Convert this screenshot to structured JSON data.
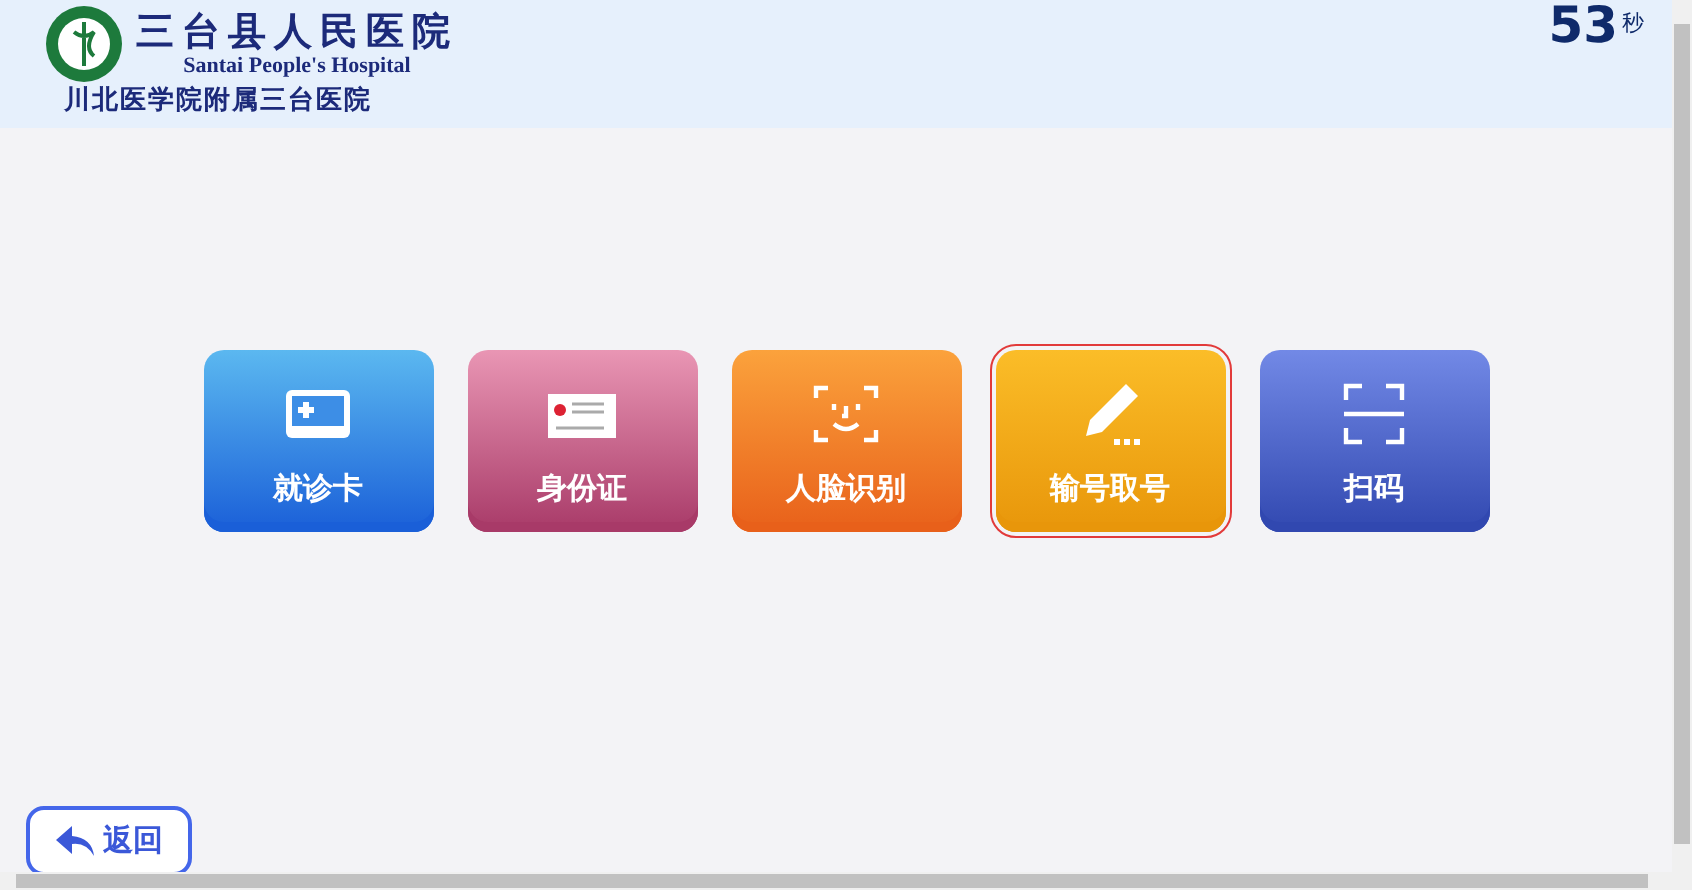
{
  "header": {
    "title": "三台县人民医院",
    "subtitle": "Santai People's Hospital",
    "affiliation": "川北医学院附属三台医院",
    "countdown": "53",
    "countdown_unit": "秒"
  },
  "options": [
    {
      "label": "就诊卡",
      "kind": "card",
      "color": "#1a5fd8",
      "selected": false
    },
    {
      "label": "身份证",
      "kind": "idcard",
      "color": "#a83a68",
      "selected": false
    },
    {
      "label": "人脸识别",
      "kind": "face",
      "color": "#e8601a",
      "selected": false
    },
    {
      "label": "输号取号",
      "kind": "input",
      "color": "#e8960a",
      "selected": true
    },
    {
      "label": "扫码",
      "kind": "scan",
      "color": "#3148b0",
      "selected": false
    }
  ],
  "back_button": {
    "label": "返回"
  }
}
